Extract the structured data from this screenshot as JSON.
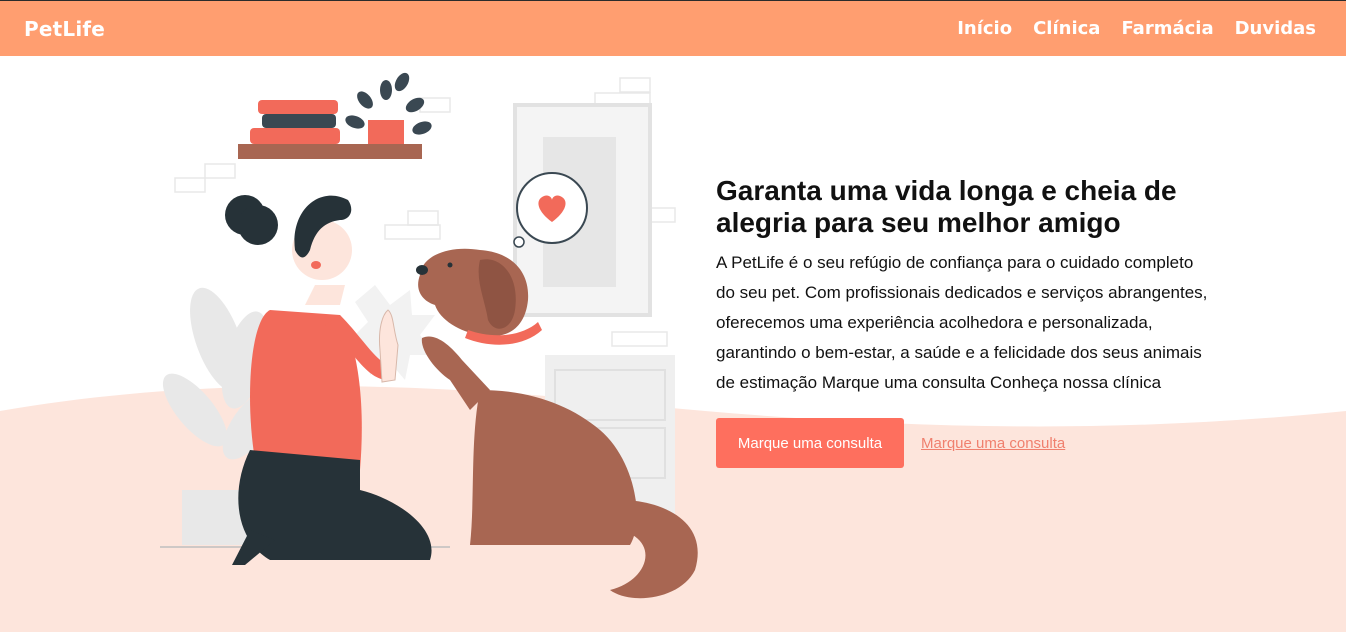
{
  "header": {
    "logo": "PetLife",
    "nav": [
      {
        "label": "Início"
      },
      {
        "label": "Clínica"
      },
      {
        "label": "Farmácia"
      },
      {
        "label": "Duvidas"
      }
    ]
  },
  "hero": {
    "title": "Garanta uma vida longa e cheia de alegria para seu melhor amigo",
    "description": "A PetLife é o seu refúgio de confiança para o cuidado completo do seu pet. Com profissionais dedicados e serviços abrangentes, oferecemos uma experiência acolhedora e personalizada, garantindo o bem-estar, a saúde e a felicidade dos seus animais de estimação Marque uma consulta Conheça nossa clínica",
    "primary_button": "Marque uma consulta",
    "secondary_link": "Marque uma consulta"
  },
  "colors": {
    "header_bg": "#ff9e70",
    "accent": "#fe6f5e",
    "wave_bg": "#fde5dc"
  }
}
